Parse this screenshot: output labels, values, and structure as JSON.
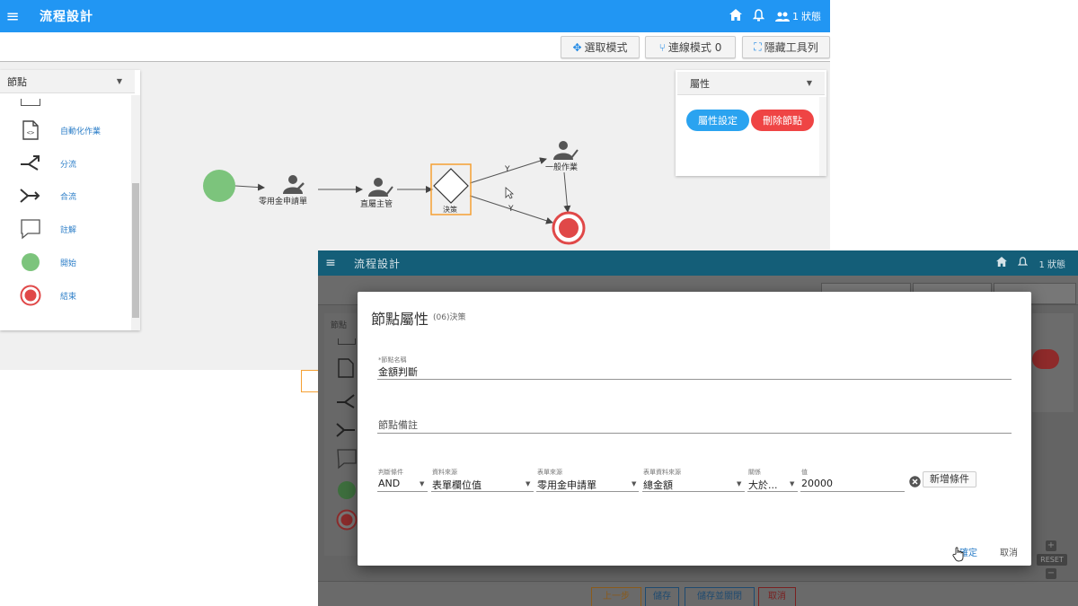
{
  "app": {
    "title": "流程設計",
    "user_count": "1",
    "status_label": "狀態"
  },
  "toolbar": {
    "select_mode": "選取模式",
    "connect_mode": "連線模式 0",
    "hide_toolbar": "隱藏工具列"
  },
  "palette": {
    "dropdown_label": "節點",
    "items": [
      {
        "label": "自動化作業",
        "icon": "file-code-icon"
      },
      {
        "label": "分流",
        "icon": "split-icon"
      },
      {
        "label": "合流",
        "icon": "merge-icon"
      },
      {
        "label": "註解",
        "icon": "comment-icon"
      },
      {
        "label": "開始",
        "icon": "start-node-icon"
      },
      {
        "label": "結束",
        "icon": "end-node-icon"
      }
    ]
  },
  "properties": {
    "dropdown_label": "屬性",
    "settings_button": "屬性設定",
    "delete_button": "刪除節點"
  },
  "diagram": {
    "nodes": {
      "task1": "零用金申請單",
      "task2": "直屬主管",
      "decision": "決策",
      "task3": "一般作業"
    },
    "edge_labels": {
      "upper": "Y",
      "lower": "Y"
    }
  },
  "dialog": {
    "title": "節點屬性",
    "subtitle": "(06)決策",
    "name_label": "*節點名稱",
    "name_value": "金額判斷",
    "remark_placeholder": "節點備註",
    "condition": {
      "logic_label": "判斷條件",
      "logic_value": "AND",
      "source_label": "資料來源",
      "source_value": "表單欄位值",
      "form_label": "表單來源",
      "form_value": "零用金申請單",
      "field_label": "表單資料來源",
      "field_value": "總金額",
      "relation_label": "關係",
      "relation_value": "大於...",
      "value_label": "值",
      "value_value": "20000"
    },
    "add_condition_button": "新增條件",
    "confirm_button": "確定",
    "cancel_button": "取消"
  },
  "front_bottom": {
    "prev_button": "上一步",
    "save_button": "儲存",
    "save_close_button": "儲存並關閉",
    "cancel_button": "取消",
    "reset_label": "RESET"
  },
  "colors": {
    "primary": "#2196f3",
    "start": "#7cc47c",
    "end": "#e04848",
    "decision_border": "#f5a033",
    "settings_pill": "#2aa3f0",
    "delete_pill": "#ef4444",
    "dim_header": "#145e78"
  }
}
